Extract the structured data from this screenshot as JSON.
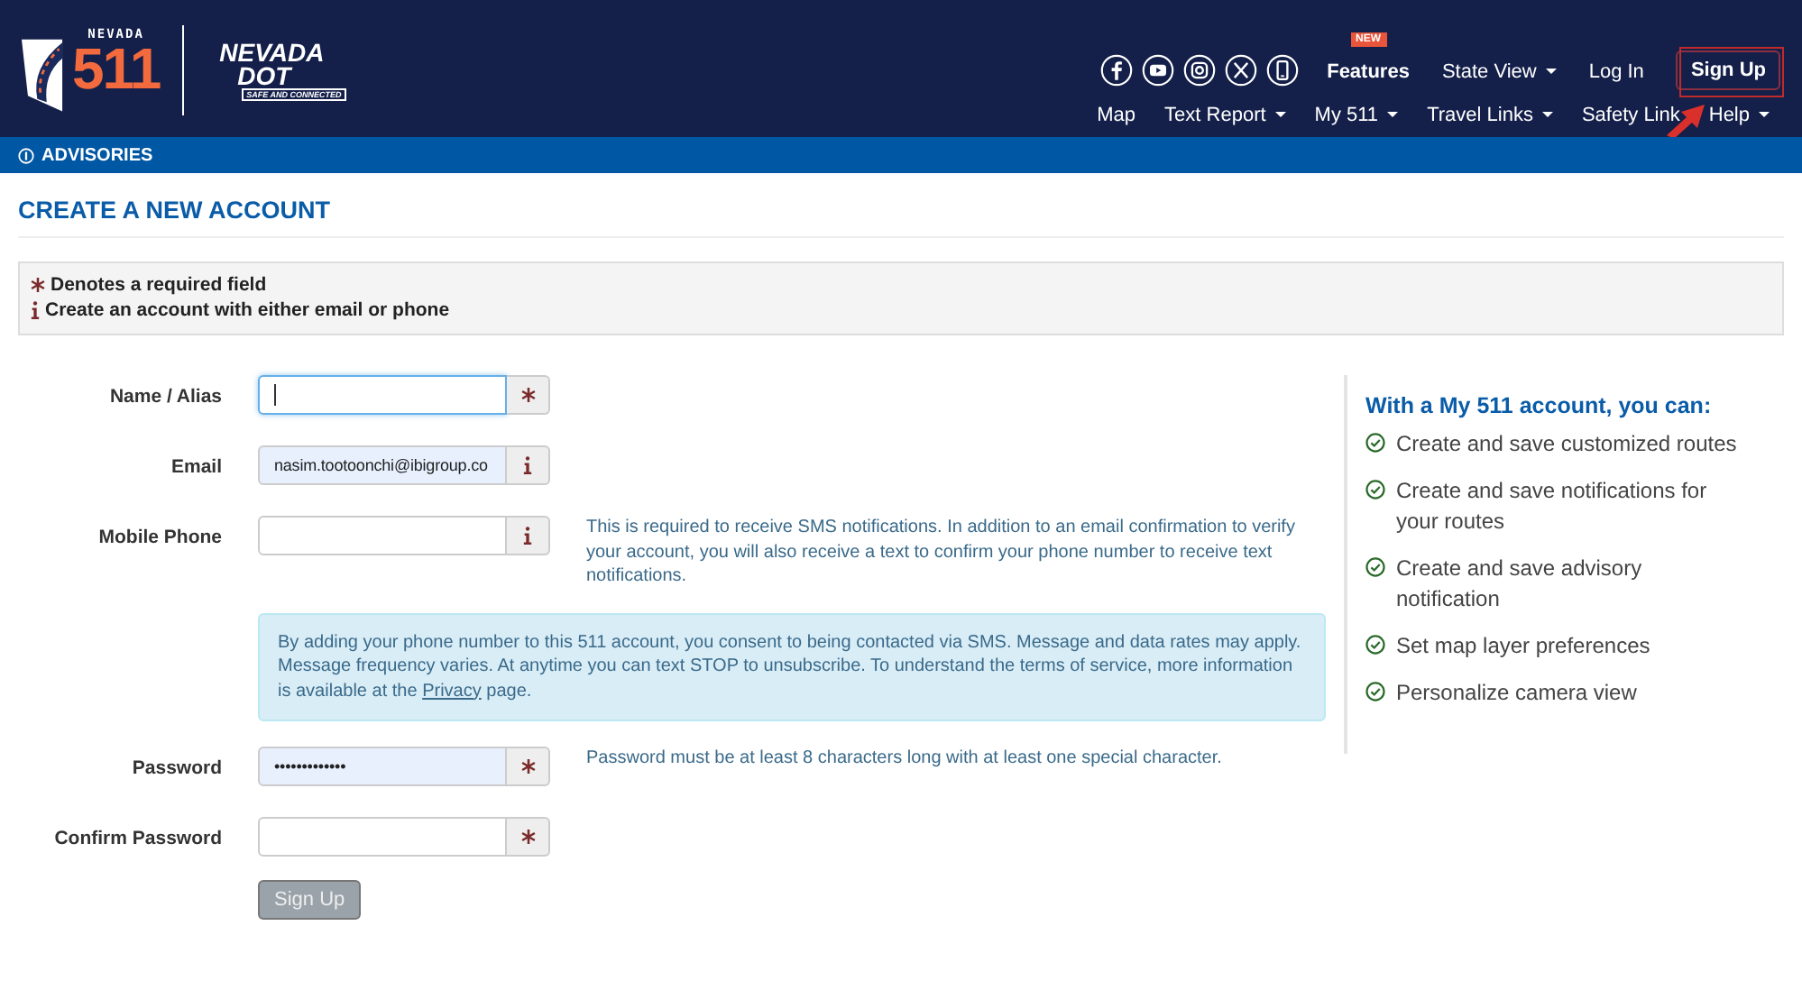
{
  "header": {
    "logo_511": {
      "top": "NEVADA",
      "number": "511"
    },
    "logo_dot": {
      "top": "NEVADA",
      "middle": "DOT",
      "tagline": "SAFE AND CONNECTED"
    },
    "social": [
      {
        "kind": "facebook"
      },
      {
        "kind": "youtube"
      },
      {
        "kind": "instagram"
      },
      {
        "kind": "x"
      },
      {
        "kind": "phone"
      }
    ],
    "top_links": [
      {
        "label": "Features",
        "badge": "NEW",
        "dropdown": false,
        "kind": "link"
      },
      {
        "label": "State View",
        "dropdown": true,
        "kind": "link"
      },
      {
        "label": "Log In",
        "dropdown": false,
        "kind": "link"
      },
      {
        "label": "Sign Up",
        "dropdown": false,
        "kind": "button"
      }
    ],
    "nav": [
      {
        "label": "Map",
        "dropdown": false
      },
      {
        "label": "Text Report",
        "dropdown": true
      },
      {
        "label": "My 511",
        "dropdown": true
      },
      {
        "label": "Travel Links",
        "dropdown": true
      },
      {
        "label": "Safety Link",
        "dropdown": false
      },
      {
        "label": "Help",
        "dropdown": true
      }
    ]
  },
  "advisories": "ADVISORIES",
  "page_title": "CREATE A NEW ACCOUNT",
  "notes": [
    {
      "kind": "required",
      "text": "Denotes a required field"
    },
    {
      "kind": "info",
      "text": "Create an account with either email or phone"
    }
  ],
  "fields": [
    {
      "label": "Name / Alias",
      "kind": "required",
      "focused": true,
      "autofilled": false
    },
    {
      "label": "Email",
      "value": "nasim.tootoonchi@ibigroup.co",
      "kind": "info",
      "focused": false,
      "autofilled": true
    },
    {
      "label": "Mobile Phone",
      "kind": "info",
      "focused": false,
      "autofilled": false,
      "help": "This is required to receive SMS notifications. In addition to an email confirmation to verify your account, you will also receive a text to confirm your phone number to receive text notifications.",
      "consent": {
        "before": "By adding your phone number to this 511 account, you consent to being contacted via SMS. Message and data rates may apply. Message frequency varies. At anytime you can text STOP to unsubscribe. To understand the terms of service, more information is available at the",
        "link": "Privacy",
        "after": "page."
      }
    },
    {
      "label": "Password",
      "value": "•••••••••••••",
      "kind": "required",
      "focused": false,
      "autofilled": true,
      "help": "Password must be at least 8 characters long with at least one special character."
    },
    {
      "label": "Confirm Password",
      "kind": "required",
      "focused": false,
      "autofilled": false
    }
  ],
  "submit": {
    "label": "Sign Up",
    "disabled": true
  },
  "benefits": {
    "title": "With a My 511 account, you can:",
    "items": [
      "Create and save customized routes",
      "Create and save notifications for your routes",
      "Create and save advisory notification",
      "Set map layer preferences",
      "Personalize camera view"
    ]
  }
}
